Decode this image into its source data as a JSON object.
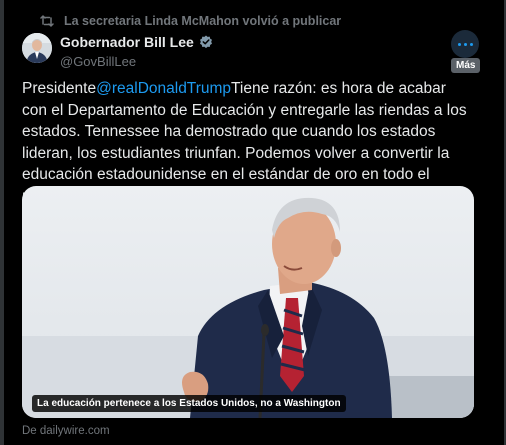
{
  "repost": {
    "icon": "repost-icon",
    "text": "La secretaria Linda McMahon volvió a publicar"
  },
  "author": {
    "display_name": "Gobernador Bill Lee",
    "handle": "@GovBillLee",
    "verified_icon": "verified-badge-icon",
    "verified_color": "#829aab"
  },
  "more": {
    "icon": "more-dots-icon",
    "tooltip": "Más"
  },
  "tweet": {
    "prefix": "Presidente",
    "mention": "@realDonaldTrump",
    "body": "Tiene razón: es hora de acabar con el Departamento de Educación y entregarle las riendas a los estados. Tennessee ha demostrado que cuando los estados lideran, los estudiantes triunfan. Podemos volver a convertir la educación estadounidense en el estándar de oro en todo el mundo."
  },
  "media": {
    "caption": "La educación pertenece a los Estados Unidos, no a Washington"
  },
  "source": {
    "text": "De dailywire.com"
  },
  "colors": {
    "background": "#000000",
    "text": "#e7e9ea",
    "secondary": "#71767b",
    "accent": "#1d9bf0"
  }
}
